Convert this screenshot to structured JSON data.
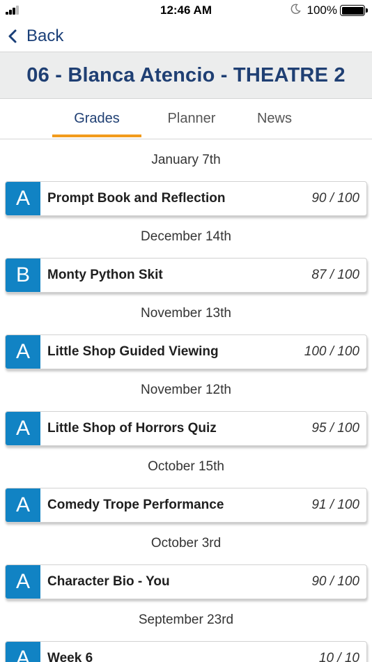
{
  "status_bar": {
    "time": "12:46 AM",
    "battery": "100%",
    "icons": [
      "signal-icon",
      "moon-icon",
      "battery-icon"
    ]
  },
  "nav": {
    "back_label": "Back",
    "back_icon": "chevron-left-icon"
  },
  "header": {
    "title": "06 - Blanca Atencio - THEATRE 2"
  },
  "tabs": [
    {
      "label": "Grades",
      "active": true
    },
    {
      "label": "Planner",
      "active": false
    },
    {
      "label": "News",
      "active": false
    }
  ],
  "colors": {
    "grade_badge": "#1183c4",
    "title": "#1f3f73",
    "tab_indicator": "#f29b1d"
  },
  "entries": [
    {
      "date": "January 7th",
      "grade": "A",
      "name": "Prompt Book and Reflection",
      "score": "90 / 100"
    },
    {
      "date": "December 14th",
      "grade": "B",
      "name": "Monty Python Skit",
      "score": "87 / 100"
    },
    {
      "date": "November 13th",
      "grade": "A",
      "name": "Little Shop Guided Viewing",
      "score": "100 / 100"
    },
    {
      "date": "November 12th",
      "grade": "A",
      "name": "Little Shop of Horrors Quiz",
      "score": "95 / 100"
    },
    {
      "date": "October 15th",
      "grade": "A",
      "name": "Comedy Trope Performance",
      "score": "91 / 100"
    },
    {
      "date": "October 3rd",
      "grade": "A",
      "name": "Character Bio - You",
      "score": "90 / 100"
    },
    {
      "date": "September 23rd",
      "grade": "A",
      "name": "Week 6",
      "score": "10 / 10"
    }
  ]
}
